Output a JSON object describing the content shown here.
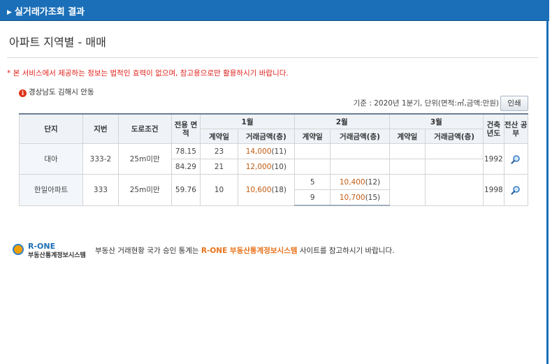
{
  "header": {
    "title": "실거래가조회 결과"
  },
  "page_title": "아파트 지역별 - 매매",
  "notice": "* 본 서비스에서 제공하는 정보는 법적인 효력이 없으며, 참고용으로만 활용하시기 바랍니다.",
  "region": "경상남도 김해시 안동",
  "basis": "기준 : 2020년 1분기, 단위(면적:㎡,금액:만원)",
  "print_label": "인쇄",
  "table": {
    "headers": {
      "complex": "단지",
      "lot": "지번",
      "road": "도로조건",
      "area": "전용 면적",
      "months": [
        "1월",
        "2월",
        "3월"
      ],
      "contract_day": "계약일",
      "amount": "거래금액(층)",
      "year_built": "건축 년도",
      "ledger": "전산 공부"
    },
    "rows": [
      {
        "name": "대아",
        "lot": "333-2",
        "road": "25m미만",
        "area1": "78.15",
        "day1": "23",
        "amt1": "14,000",
        "floor1": "(11)",
        "area2": "84.29",
        "day2": "21",
        "amt2": "12,000",
        "floor2": "(10)",
        "year": "1992"
      },
      {
        "name": "한일아파트",
        "lot": "333",
        "road": "25m미만",
        "area": "59.76",
        "day_jan": "10",
        "amt_jan": "10,600",
        "floor_jan": "(18)",
        "feb": [
          {
            "day": "5",
            "amt": "10,400",
            "floor": "(12)"
          },
          {
            "day": "9",
            "amt": "10,700",
            "floor": "(15)"
          }
        ],
        "year": "1998"
      }
    ]
  },
  "rone": {
    "brand": "R-ONE",
    "brand_sub": "부동산통계정보시스템",
    "text_before": "부동산 거래현황 국가 승인 통계는",
    "text_highlight": "R-ONE 부동산통계정보시스템",
    "text_after": "사이트를 참고하시기 바랍니다."
  },
  "colors": {
    "header_bar": "#1a6fb8",
    "notice": "#e0201a",
    "amount": "#c25b12",
    "highlight": "#e8721a"
  },
  "icons": {
    "search": "magnifier-icon",
    "info": "info-icon"
  }
}
